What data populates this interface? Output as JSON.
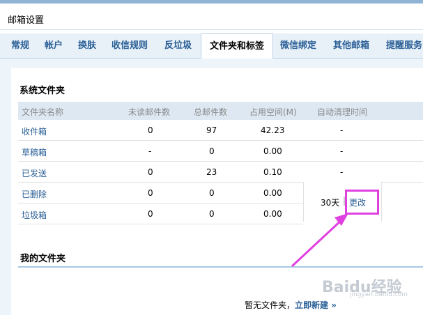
{
  "header": {
    "title": "邮箱设置"
  },
  "tabs": [
    {
      "label": "常规"
    },
    {
      "label": "帐户"
    },
    {
      "label": "换肤"
    },
    {
      "label": "收信规则"
    },
    {
      "label": "反垃圾"
    },
    {
      "label": "文件夹和标签",
      "active": true
    },
    {
      "label": "微信绑定"
    },
    {
      "label": "其他邮箱"
    },
    {
      "label": "提醒服务"
    }
  ],
  "system_folders": {
    "title": "系统文件夹",
    "columns": [
      "文件夹名称",
      "未读邮件数",
      "总邮件数",
      "占用空间(M)",
      "自动清理时间"
    ],
    "rows": [
      {
        "name": "收件箱",
        "unread": "0",
        "total": "97",
        "size": "42.23",
        "cleanup": "-"
      },
      {
        "name": "草稿箱",
        "unread": "-",
        "total": "0",
        "size": "0.00",
        "cleanup": "-"
      },
      {
        "name": "已发送",
        "unread": "0",
        "total": "23",
        "size": "0.10",
        "cleanup": "-"
      },
      {
        "name": "已删除",
        "unread": "0",
        "total": "0",
        "size": "0.00"
      },
      {
        "name": "垃圾箱",
        "unread": "0",
        "total": "0",
        "size": "0.00"
      }
    ],
    "merged_cleanup": {
      "days": "30天",
      "separator": "|",
      "change_label": "更改"
    }
  },
  "my_folders": {
    "title": "我的文件夹",
    "empty_text": "暂无文件夹，",
    "create_link": "立即新建 »"
  },
  "watermark": {
    "brand": "Baidu经验",
    "sub": "jingyan.baidu.com"
  },
  "colors": {
    "tab_text": "#2a5f96",
    "highlight": "#e040e0",
    "header_bar": "#8fb4d6"
  }
}
